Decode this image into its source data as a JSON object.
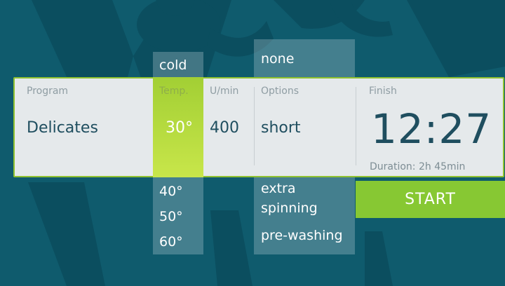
{
  "background": {
    "color": "#0f5b6d",
    "logo": "ladybug-v-logo"
  },
  "program": {
    "label": "Program",
    "value": "Delicates"
  },
  "temperature": {
    "label": "Temp.",
    "selected": "30°",
    "above": [
      "cold"
    ],
    "below": [
      "40°",
      "50°",
      "60°"
    ]
  },
  "spin": {
    "label": "U/min",
    "value": "400"
  },
  "options": {
    "label": "Options",
    "selected": "short",
    "above": [
      "none"
    ],
    "below_line1": "extra",
    "below_line2": "spinning",
    "below_2": "pre-washing"
  },
  "finish": {
    "label": "Finish",
    "time": "12:27",
    "duration": "Duration: 2h 45min"
  },
  "start_button": {
    "label": "START",
    "color": "#87c833"
  },
  "accent_color": "#a2cf34"
}
